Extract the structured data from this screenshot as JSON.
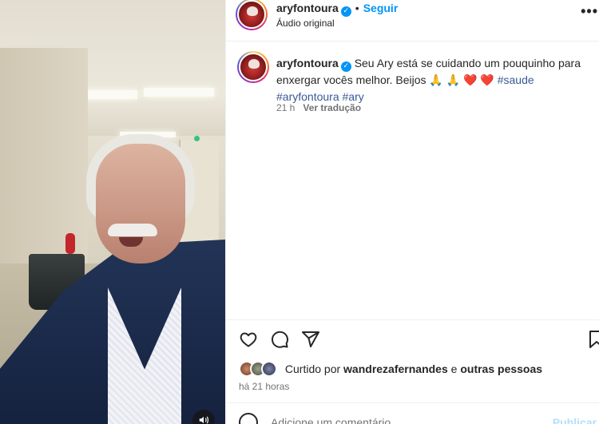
{
  "post": {
    "username": "aryfontoura",
    "verified_mark": "✓",
    "separator": "•",
    "follow_label": "Seguir",
    "audio_label": "Áudio original",
    "more_label": "•••"
  },
  "caption": {
    "username": "aryfontoura",
    "text": "Seu Ary está se cuidando um pouquinho para enxergar vocês melhor. Beijos 🙏 🙏 ❤️ ❤️",
    "hashtags": [
      "#saude",
      "#aryfontoura",
      "#ary"
    ],
    "time": "21 h",
    "translate_label": "Ver tradução"
  },
  "likes": {
    "prefix": "Curtido por",
    "user": "wandrezafernandes",
    "joiner": "e",
    "others": "outras pessoas"
  },
  "post_time": "há 21 horas",
  "add_comment": {
    "placeholder": "Adicione um comentário...",
    "publish_label": "Publicar"
  },
  "icons": {
    "like": "heart-icon",
    "comment": "comment-icon",
    "share": "paper-plane-icon",
    "save": "bookmark-icon",
    "sound": "speaker-icon",
    "emoji": "emoji-icon"
  },
  "colors": {
    "link_blue": "#0095f6",
    "hashtag": "#375a96",
    "muted": "#737373"
  }
}
